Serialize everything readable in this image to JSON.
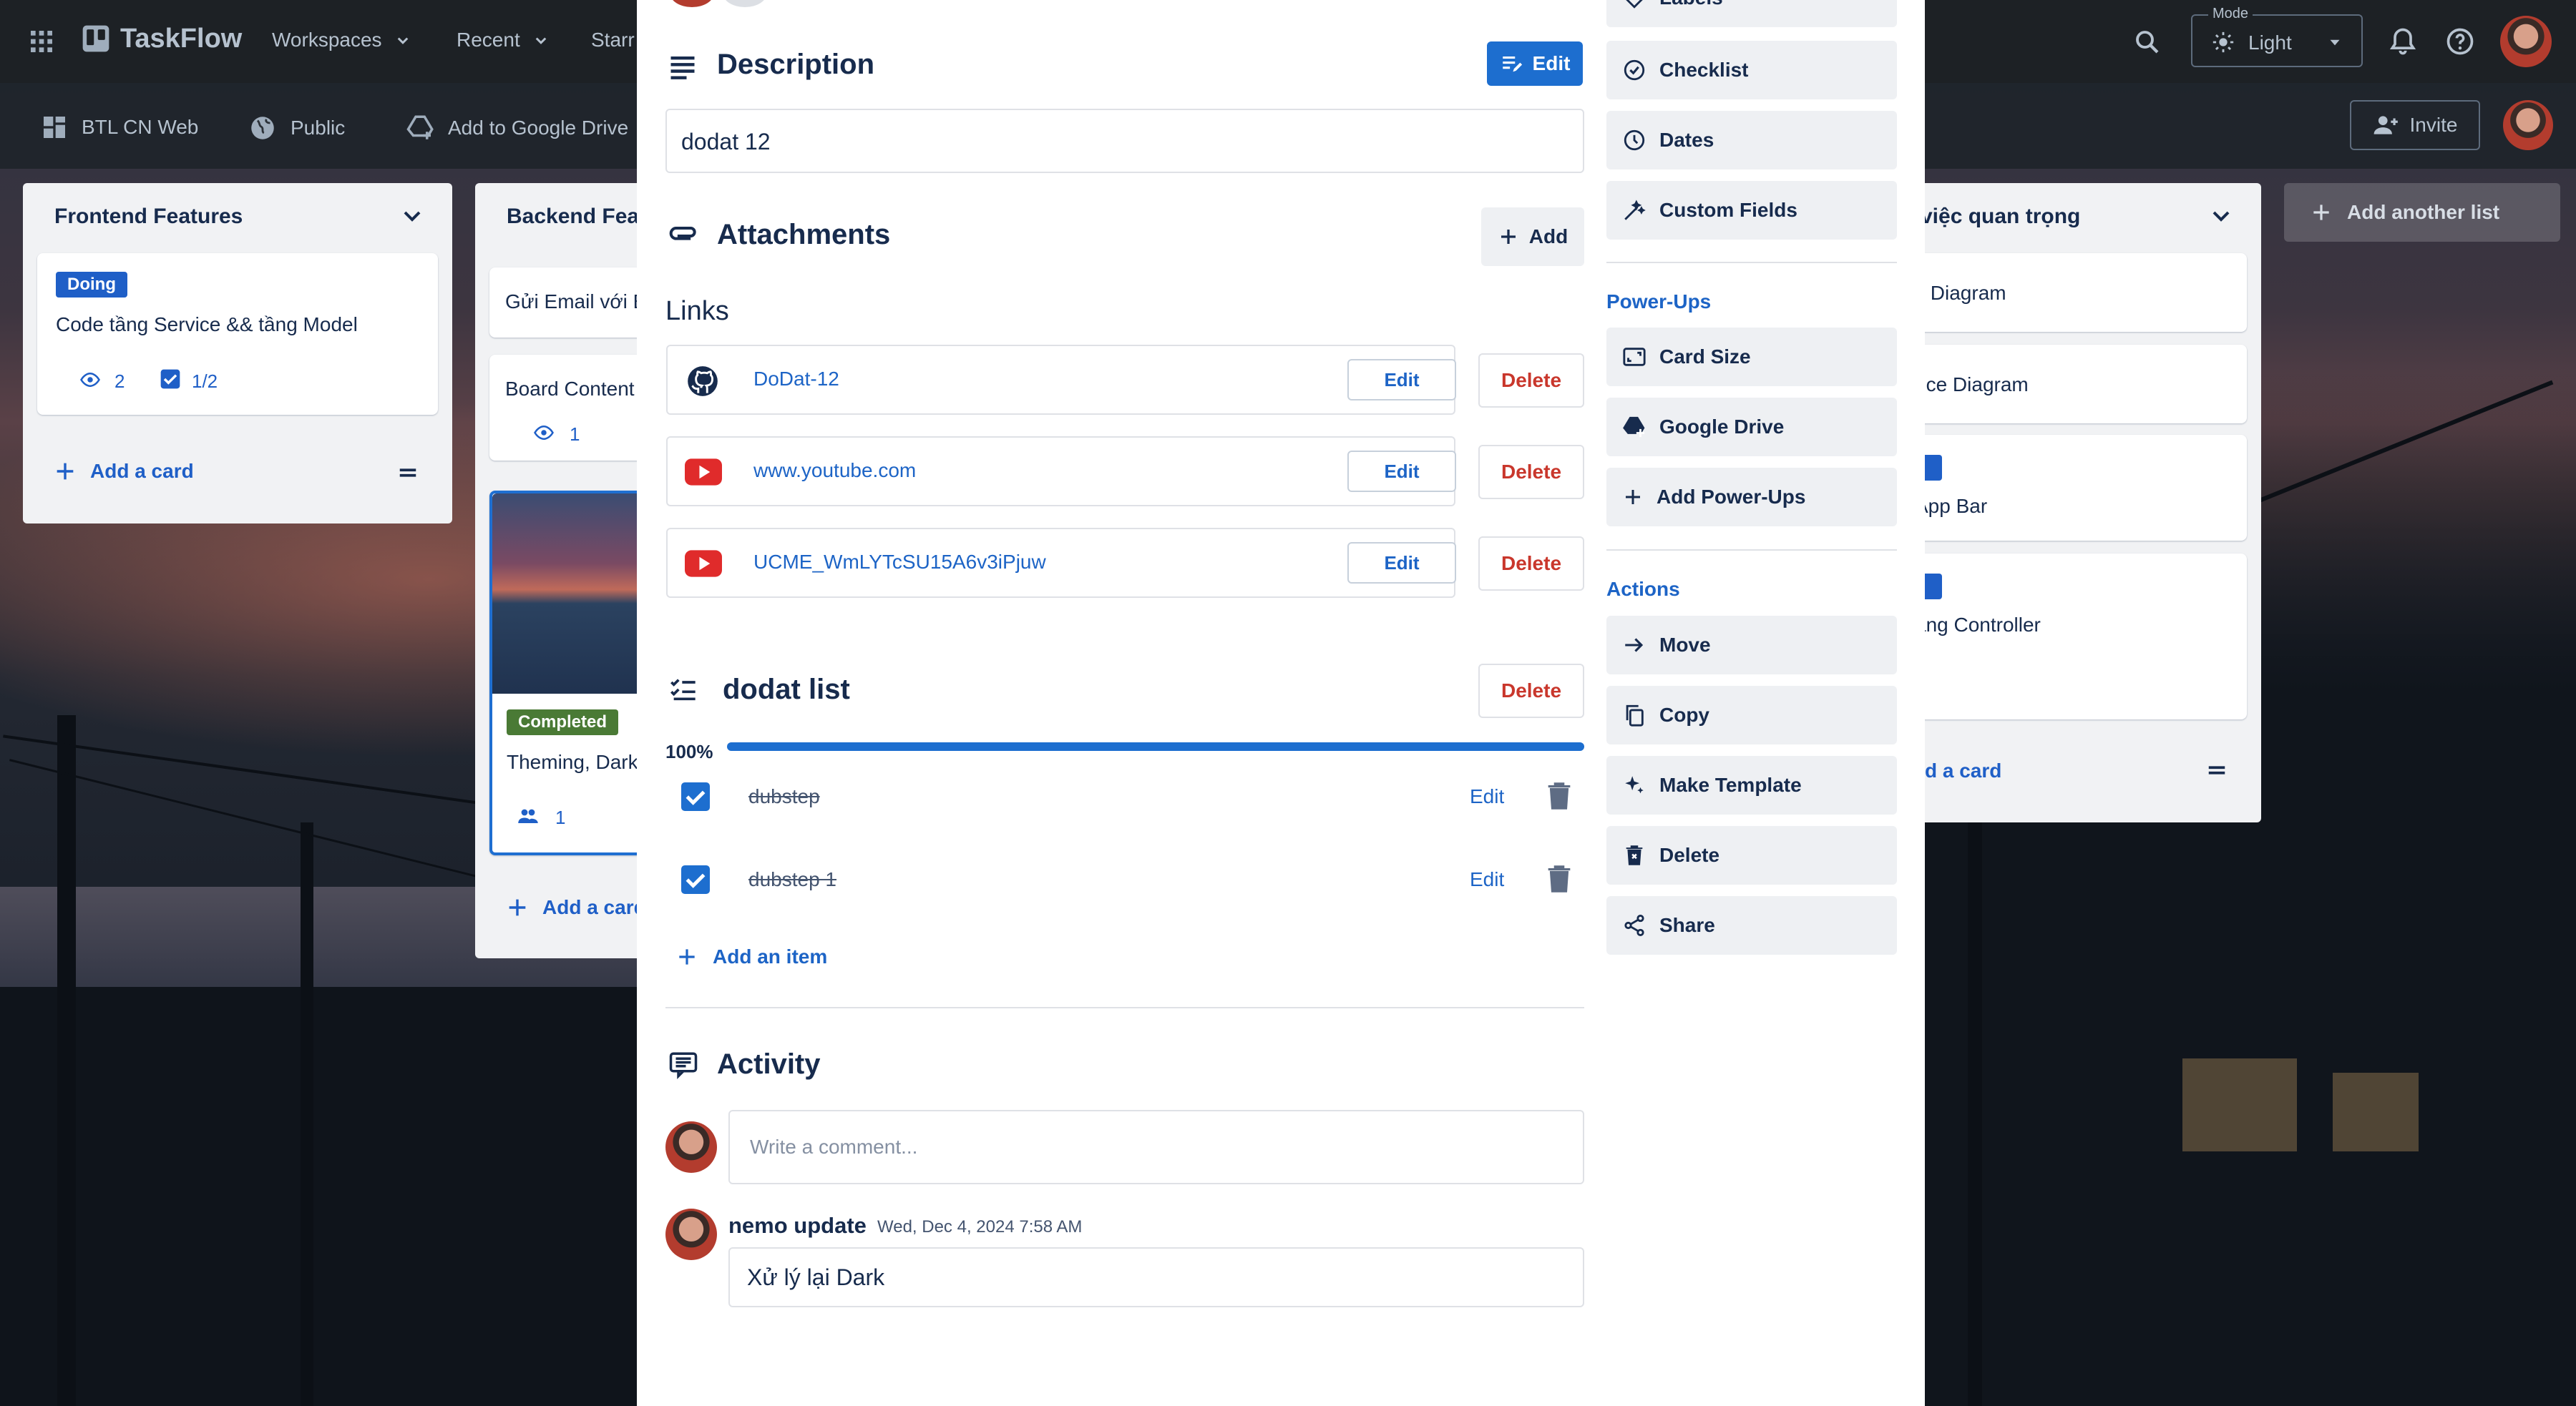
{
  "topbar": {
    "app_name": "TaskFlow",
    "workspaces": "Workspaces",
    "recent": "Recent",
    "starred": "Starr",
    "mode_label": "Mode",
    "mode_value": "Light"
  },
  "boardbar": {
    "board_name": "BTL CN Web",
    "visibility": "Public",
    "add_drive": "Add to Google Drive",
    "invite": "Invite"
  },
  "lists": {
    "frontend": {
      "title": "Frontend Features",
      "card1_label": "Doing",
      "card1_title": "Code tầng Service && tầng Model",
      "card1_watch": "2",
      "card1_check": "1/2",
      "add_card": "Add a card"
    },
    "backend": {
      "title": "Backend Featu",
      "card1_title": "Gửi Email với E",
      "card2_title": "Board Content",
      "card2_watch": "1",
      "card3_label": "Completed",
      "card3_title": "Theming, Dark",
      "card3_members": "1",
      "add_card": "Add a card"
    },
    "important": {
      "title": "việc quan trọng",
      "card1_title": "y Diagram",
      "card2_title": "nce Diagram",
      "card3_title": "App Bar",
      "card4_title": "ầng Controller",
      "add_card": "d a card"
    },
    "add_another": "Add another list"
  },
  "modal": {
    "description_title": "Description",
    "description_edit": "Edit",
    "description_text": "dodat 12",
    "attachments_title": "Attachments",
    "attachments_add": "Add",
    "links_title": "Links",
    "links": [
      {
        "text": "DoDat-12",
        "edit": "Edit",
        "delete": "Delete"
      },
      {
        "text": "www.youtube.com",
        "edit": "Edit",
        "delete": "Delete"
      },
      {
        "text": "UCME_WmLYTcSU15A6v3iPjuw",
        "edit": "Edit",
        "delete": "Delete"
      }
    ],
    "checklist_title": "dodat list",
    "checklist_delete": "Delete",
    "checklist_progress_text": "100%",
    "checklist_progress": 1.0,
    "checklist_items": [
      {
        "text": "dubstep",
        "edit": "Edit",
        "checked": true
      },
      {
        "text": "dubstep 1",
        "edit": "Edit",
        "checked": true
      }
    ],
    "add_item": "Add an item",
    "activity_title": "Activity",
    "comment_placeholder": "Write a comment...",
    "comment_author": "nemo update",
    "comment_time": "Wed, Dec 4, 2024 7:58 AM",
    "comment_text": "Xử lý lại Dark"
  },
  "sidebar": {
    "labels": "Labels",
    "checklist": "Checklist",
    "dates": "Dates",
    "custom_fields": "Custom Fields",
    "powerups_heading": "Power-Ups",
    "card_size": "Card Size",
    "google_drive": "Google Drive",
    "add_powerups": "Add Power-Ups",
    "actions_heading": "Actions",
    "move": "Move",
    "copy": "Copy",
    "make_template": "Make Template",
    "delete": "Delete",
    "share": "Share"
  },
  "colors": {
    "accent": "#1d6ecf",
    "danger": "#c9372c",
    "doing_label": "#1f5fc7",
    "completed_label": "#4a7a35"
  }
}
